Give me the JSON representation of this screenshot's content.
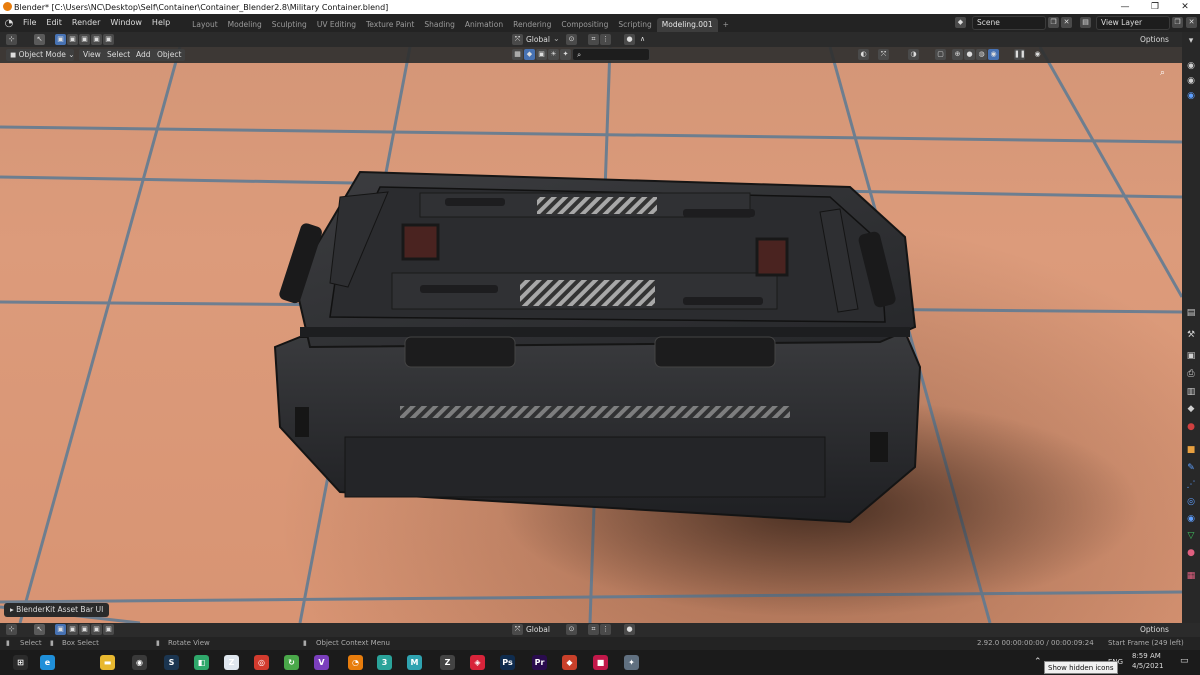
{
  "window": {
    "title": "Blender* [C:\\Users\\NC\\Desktop\\Self\\Container\\Container_Blender2.8\\Military Container.blend]",
    "controls": [
      "—",
      "❐",
      "✕"
    ]
  },
  "menu": {
    "items": [
      "File",
      "Edit",
      "Render",
      "Window",
      "Help"
    ]
  },
  "workspaces": {
    "tabs": [
      "Layout",
      "Modeling",
      "Sculpting",
      "UV Editing",
      "Texture Paint",
      "Shading",
      "Animation",
      "Rendering",
      "Compositing",
      "Scripting",
      "Modeling.001"
    ],
    "active_index": 10,
    "add_label": "+"
  },
  "scene": {
    "value": "Scene"
  },
  "view_layer": {
    "value": "View Layer"
  },
  "tool_header": {
    "orientation": "Global",
    "options_label": "Options"
  },
  "viewport_header": {
    "mode": "Object Mode",
    "menus": [
      "View",
      "Select",
      "Add",
      "Object"
    ]
  },
  "asset_bar": {
    "label": "BlenderKit Asset Bar UI"
  },
  "bottom_header": {
    "orientation": "Global",
    "options_label": "Options"
  },
  "status": {
    "select": "Select",
    "box_select": "Box Select",
    "rotate_view": "Rotate View",
    "context_menu": "Object Context Menu",
    "version_time": "2.92.0   00:00:00:00 / 00:00:09:24",
    "start_frame": "Start Frame (249 left)"
  },
  "taskbar": {
    "language": "ENG",
    "time": "8:59 AM",
    "date": "4/5/2021",
    "tooltip": "Show hidden icons",
    "apps": [
      {
        "icon": "windows-start-icon",
        "glyph": "⊞",
        "color": "#2b2b2b"
      },
      {
        "icon": "edge-icon",
        "glyph": "e",
        "color": "#1f8fd9"
      },
      {
        "icon": "file-explorer-icon",
        "glyph": "▬",
        "color": "#e8b830"
      },
      {
        "icon": "obs-icon",
        "glyph": "◉",
        "color": "#3a3a3a"
      },
      {
        "icon": "steam-icon",
        "glyph": "S",
        "color": "#1b3550"
      },
      {
        "icon": "game-icon",
        "glyph": "◧",
        "color": "#2fa86b"
      },
      {
        "icon": "zoom-icon",
        "glyph": "Z",
        "color": "#dfe6ee"
      },
      {
        "icon": "chrome-icon",
        "glyph": "◎",
        "color": "#d23b2e"
      },
      {
        "icon": "refresh-app-icon",
        "glyph": "↻",
        "color": "#4aa84a"
      },
      {
        "icon": "visual-studio-icon",
        "glyph": "V",
        "color": "#7b3fbd"
      },
      {
        "icon": "blender-icon",
        "glyph": "◔",
        "color": "#e87d0d"
      },
      {
        "icon": "3ds-max-icon",
        "glyph": "3",
        "color": "#2aa39a"
      },
      {
        "icon": "maya-icon",
        "glyph": "M",
        "color": "#2fa3b0"
      },
      {
        "icon": "zbrush-icon",
        "glyph": "Z",
        "color": "#444444"
      },
      {
        "icon": "cast-icon",
        "glyph": "◈",
        "color": "#d8243a"
      },
      {
        "icon": "photoshop-icon",
        "glyph": "Ps",
        "color": "#0f2c4e"
      },
      {
        "icon": "premiere-icon",
        "glyph": "Pr",
        "color": "#2a0c4e"
      },
      {
        "icon": "substance-icon",
        "glyph": "◆",
        "color": "#c8402a"
      },
      {
        "icon": "record-icon",
        "glyph": "■",
        "color": "#c2184a"
      },
      {
        "icon": "misc-app-icon",
        "glyph": "✦",
        "color": "#607080"
      }
    ]
  }
}
